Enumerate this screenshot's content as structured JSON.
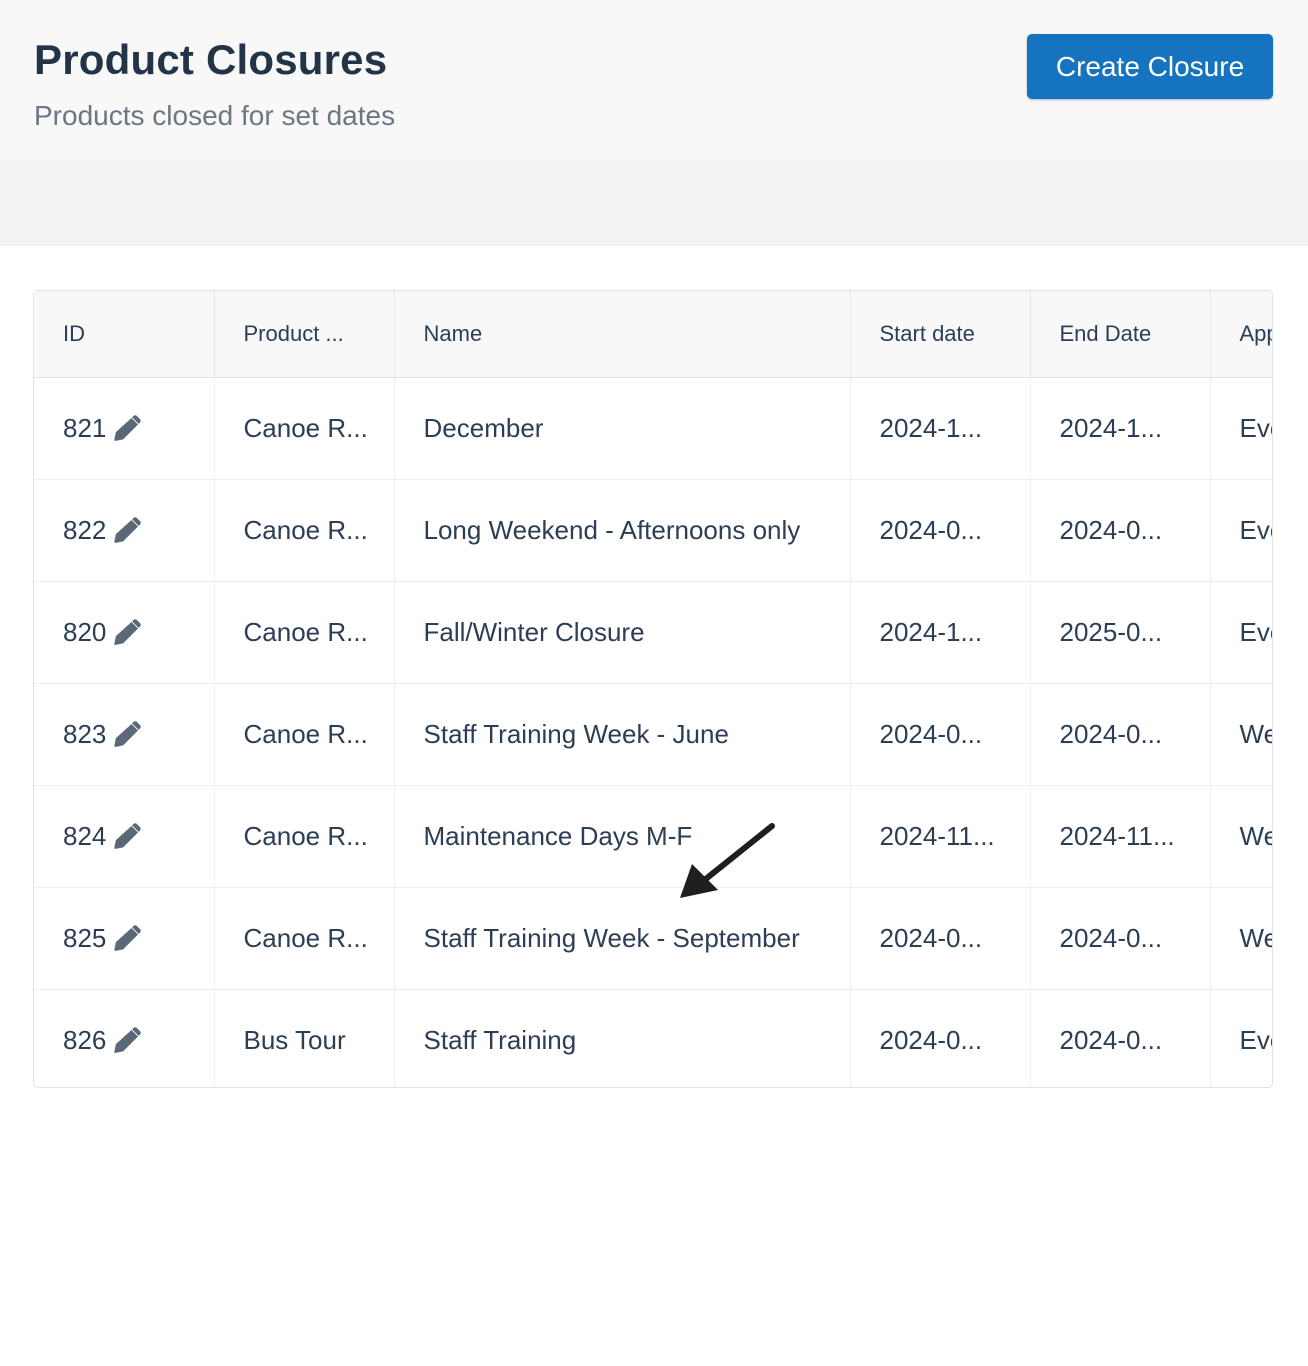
{
  "header": {
    "title": "Product Closures",
    "subtitle": "Products closed for set dates",
    "create_button_label": "Create Closure"
  },
  "table": {
    "columns": [
      "ID",
      "Product ...",
      "Name",
      "Start date",
      "End Date",
      "App"
    ],
    "rows": [
      {
        "id": "821",
        "product": "Canoe R...",
        "name": "December",
        "start": "2024-1...",
        "end": "2024-1...",
        "applies": "Eve"
      },
      {
        "id": "822",
        "product": "Canoe R...",
        "name": "Long Weekend - Afternoons only",
        "start": "2024-0...",
        "end": "2024-0...",
        "applies": "Eve"
      },
      {
        "id": "820",
        "product": "Canoe R...",
        "name": "Fall/Winter Closure",
        "start": "2024-1...",
        "end": "2025-0...",
        "applies": "Eve"
      },
      {
        "id": "823",
        "product": "Canoe R...",
        "name": "Staff Training Week - June",
        "start": "2024-0...",
        "end": "2024-0...",
        "applies": "We"
      },
      {
        "id": "824",
        "product": "Canoe R...",
        "name": "Maintenance Days M-F",
        "start": "2024-11...",
        "end": "2024-11...",
        "applies": "We"
      },
      {
        "id": "825",
        "product": "Canoe R...",
        "name": "Staff Training Week - September",
        "start": "2024-0...",
        "end": "2024-0...",
        "applies": "We"
      },
      {
        "id": "826",
        "product": "Bus Tour",
        "name": "Staff Training",
        "start": "2024-0...",
        "end": "2024-0...",
        "applies": "Eve"
      }
    ]
  },
  "icons": {
    "edit": "pencil-icon",
    "annotation": "arrow-icon"
  },
  "colors": {
    "accent": "#1673bf",
    "text": "#2c3e55",
    "muted": "#6b7785",
    "icon": "#5a6878"
  }
}
